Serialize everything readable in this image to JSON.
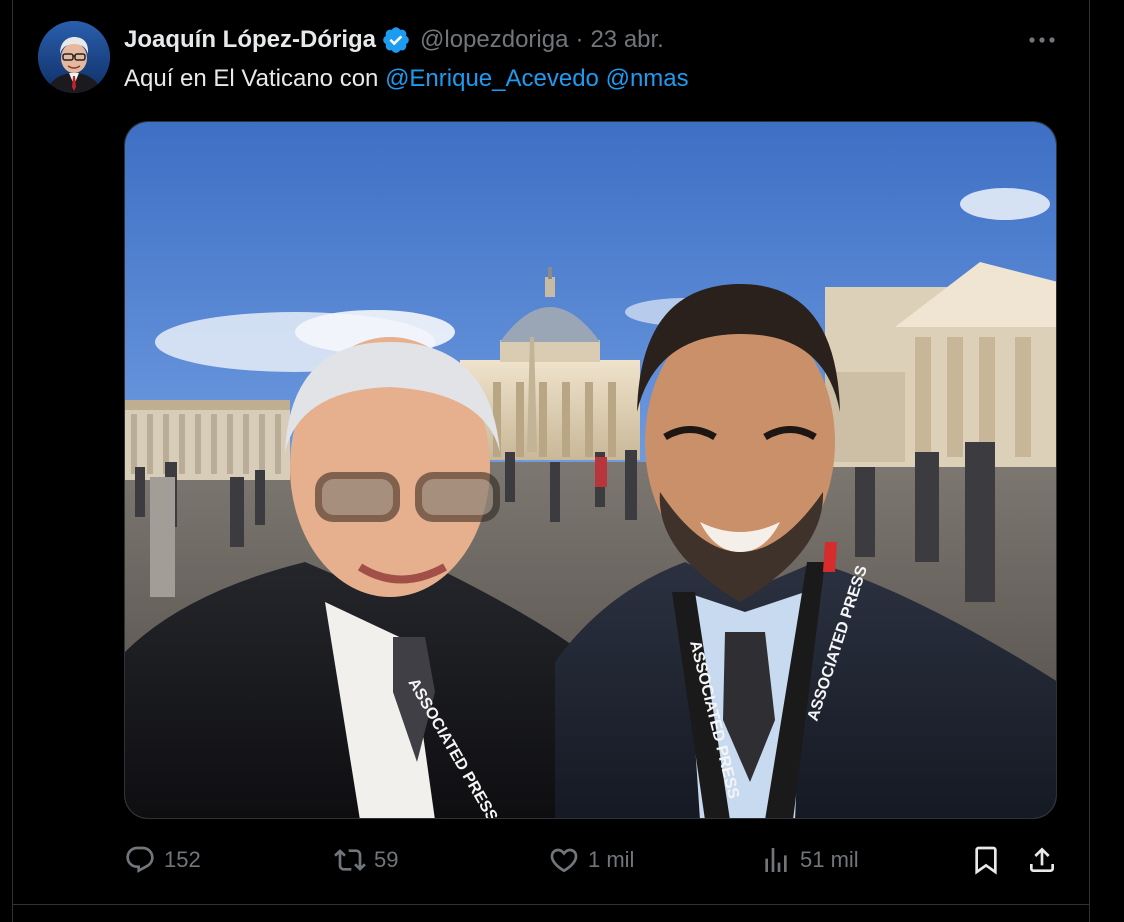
{
  "tweet": {
    "author": {
      "display_name": "Joaquín López-Dóriga",
      "handle": "@lopezdoriga",
      "verified": true,
      "avatar_icon": "avatar-photo"
    },
    "separator": "·",
    "timestamp": "23 abr.",
    "text": {
      "prefix": "Aquí en El Vaticano con ",
      "mentions": [
        "@Enrique_Acevedo",
        "@nmas"
      ]
    },
    "media": {
      "icon": "photo-vatican-selfie",
      "lanyard_text": "ASSOCIATED PRESS"
    },
    "actions": {
      "reply": {
        "icon": "reply-icon",
        "count": "152"
      },
      "retweet": {
        "icon": "retweet-icon",
        "count": "59"
      },
      "like": {
        "icon": "like-icon",
        "count": "1 mil"
      },
      "views": {
        "icon": "views-icon",
        "count": "51 mil"
      },
      "bookmark": {
        "icon": "bookmark-icon"
      },
      "share": {
        "icon": "share-icon"
      }
    },
    "more_icon": "more-icon"
  },
  "colors": {
    "background": "#000000",
    "primary_text": "#e7e9ea",
    "secondary_text": "#71767b",
    "accent": "#1d9bf0",
    "border": "#2f3336"
  }
}
